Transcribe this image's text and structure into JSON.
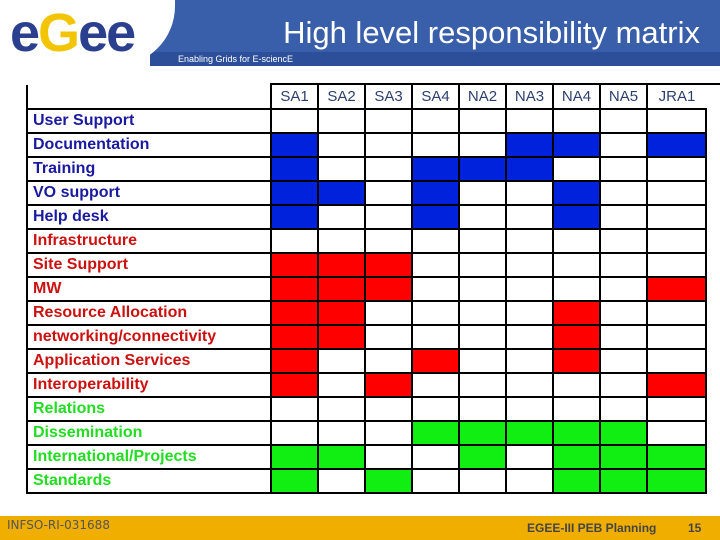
{
  "header": {
    "logo": {
      "text": "eGee",
      "part1": "e",
      "part2": "G",
      "part3": "ee"
    },
    "title": "High level responsibility matrix",
    "subtitle": "Enabling Grids for E-sciencE"
  },
  "colors": {
    "B": "#0022dd",
    "R": "#ff0000",
    "G": "#11ee11",
    "blue_text": "#1a1aa0",
    "red_text": "#cc1111",
    "green_text": "#22dd22"
  },
  "matrix": {
    "columns": [
      "SA1",
      "SA2",
      "SA3",
      "SA4",
      "NA2",
      "NA3",
      "NA4",
      "NA5",
      "JRA1"
    ],
    "rows": [
      {
        "label": "User Support",
        "group": "blue_text",
        "cells": [
          "",
          "",
          "",
          "",
          "",
          "",
          "",
          "",
          ""
        ]
      },
      {
        "label": "Documentation",
        "group": "blue_text",
        "cells": [
          "B",
          "",
          "",
          "",
          "",
          "B",
          "B",
          "",
          "B"
        ]
      },
      {
        "label": "Training",
        "group": "blue_text",
        "cells": [
          "B",
          "",
          "",
          "B",
          "B",
          "B",
          "",
          "",
          ""
        ]
      },
      {
        "label": "VO support",
        "group": "blue_text",
        "cells": [
          "B",
          "B",
          "",
          "B",
          "",
          "",
          "B",
          "",
          ""
        ]
      },
      {
        "label": "Help desk",
        "group": "blue_text",
        "cells": [
          "B",
          "",
          "",
          "B",
          "",
          "",
          "B",
          "",
          ""
        ]
      },
      {
        "label": "Infrastructure",
        "group": "red_text",
        "cells": [
          "",
          "",
          "",
          "",
          "",
          "",
          "",
          "",
          ""
        ]
      },
      {
        "label": "Site Support",
        "group": "red_text",
        "cells": [
          "R",
          "R",
          "R",
          "",
          "",
          "",
          "",
          "",
          ""
        ]
      },
      {
        "label": "MW",
        "group": "red_text",
        "cells": [
          "R",
          "R",
          "R",
          "",
          "",
          "",
          "",
          "",
          "R"
        ]
      },
      {
        "label": "Resource Allocation",
        "group": "red_text",
        "cells": [
          "R",
          "R",
          "",
          "",
          "",
          "",
          "R",
          "",
          ""
        ]
      },
      {
        "label": "networking/connectivity",
        "group": "red_text",
        "cells": [
          "R",
          "R",
          "",
          "",
          "",
          "",
          "R",
          "",
          ""
        ]
      },
      {
        "label": "Application Services",
        "group": "red_text",
        "cells": [
          "R",
          "",
          "",
          "R",
          "",
          "",
          "R",
          "",
          ""
        ]
      },
      {
        "label": "Interoperability",
        "group": "red_text",
        "cells": [
          "R",
          "",
          "R",
          "",
          "",
          "",
          "",
          "",
          "R"
        ]
      },
      {
        "label": "Relations",
        "group": "green_text",
        "cells": [
          "",
          "",
          "",
          "",
          "",
          "",
          "",
          "",
          ""
        ]
      },
      {
        "label": "Dissemination",
        "group": "green_text",
        "cells": [
          "",
          "",
          "",
          "G",
          "G",
          "G",
          "G",
          "G",
          ""
        ]
      },
      {
        "label": "International/Projects",
        "group": "green_text",
        "cells": [
          "G",
          "G",
          "",
          "",
          "G",
          "",
          "G",
          "G",
          "G"
        ]
      },
      {
        "label": "Standards",
        "group": "green_text",
        "cells": [
          "G",
          "",
          "G",
          "",
          "",
          "",
          "G",
          "G",
          "G"
        ]
      }
    ]
  },
  "footer": {
    "left": "INFSO-RI-031688",
    "center": "EGEE-III PEB Planning",
    "page": "15"
  }
}
